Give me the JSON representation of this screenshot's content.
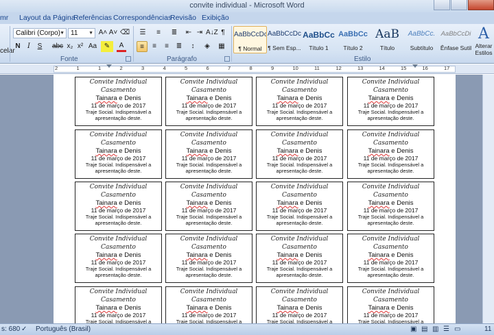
{
  "window": {
    "title": "convite individual - Microsoft Word"
  },
  "tabs": [
    "mr",
    "Layout da Página",
    "Referências",
    "Correspondências",
    "Revisão",
    "Exibição"
  ],
  "ribbon": {
    "left_strip_label": "celar",
    "font_name": "Calibri (Corpo)",
    "font_size": "11",
    "group_font": "Fonte",
    "group_paragraph": "Parágrafo",
    "group_styles": "Estilo",
    "change_styles_line1": "Alterar",
    "change_styles_line2": "Estilos",
    "grow_font": "A˄",
    "shrink_font": "A˅",
    "bold": "N",
    "italic": "I",
    "underline": "S",
    "strike": "abc",
    "subscript": "x₂",
    "superscript": "x²",
    "change_case": "Aa",
    "font_color": "A",
    "pilcrow": "¶",
    "sort": "A↓Z"
  },
  "styles": [
    {
      "sample": "AaBbCcDc",
      "name": "¶ Normal",
      "selected": true
    },
    {
      "sample": "AaBbCcDc",
      "name": "¶ Sem Esp...",
      "selected": false
    },
    {
      "sample": "AaBbCc",
      "name": "Título 1",
      "selected": false
    },
    {
      "sample": "AaBbCc",
      "name": "Título 2",
      "selected": false
    },
    {
      "sample": "AaB",
      "name": "Título",
      "selected": false
    },
    {
      "sample": "AaBbCc.",
      "name": "Subtítulo",
      "selected": false
    },
    {
      "sample": "AaBbCcDi",
      "name": "Ênfase Sutil",
      "selected": false
    }
  ],
  "ruler": {
    "numbers": [
      "2",
      "1",
      "1",
      "2",
      "3",
      "4",
      "5",
      "6",
      "7",
      "8",
      "9",
      "10",
      "11",
      "12",
      "13",
      "14",
      "15",
      "16",
      "17"
    ]
  },
  "card": {
    "line1": "Convite Individual",
    "line2": "Casamento",
    "bride": "Tainara",
    "couple_rest": " e Denis",
    "date": "11 de março de 2017",
    "dress_line1": "Traje Social. Indispensável a",
    "dress_line2": "apresentação deste."
  },
  "status": {
    "words": "s: 680",
    "language": "Português (Brasil)",
    "zoom": "11"
  }
}
